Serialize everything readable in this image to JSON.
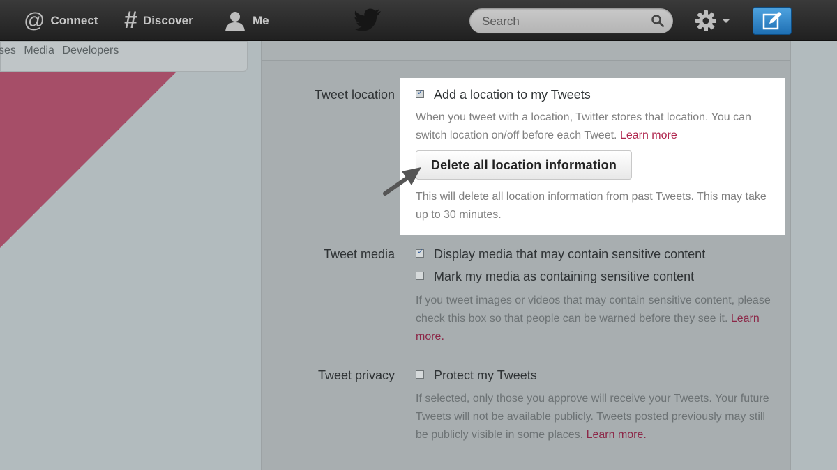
{
  "nav": {
    "connect": "Connect",
    "discover": "Discover",
    "me": "Me",
    "search_placeholder": "Search"
  },
  "icons": {
    "connect": "at-sign-icon",
    "discover": "hashtag-icon",
    "me": "person-icon",
    "logo": "twitter-bird-icon",
    "search": "search-icon",
    "settings": "gear-icon",
    "compose": "compose-icon"
  },
  "left_links": [
    "ses",
    "Media",
    "Developers"
  ],
  "settings": {
    "location": {
      "label": "Tweet location",
      "checkbox_label": "Add a location to my Tweets",
      "checked": true,
      "help": "When you tweet with a location, Twitter stores that location. You can switch location on/off before each Tweet.",
      "help_link": "Learn more",
      "button": "Delete all location information",
      "button_help": "This will delete all location information from past Tweets. This may take up to 30 minutes."
    },
    "media": {
      "label": "Tweet media",
      "option1": "Display media that may contain sensitive content",
      "option1_checked": true,
      "option2": "Mark my media as containing sensitive content",
      "option2_checked": false,
      "help": "If you tweet images or videos that may contain sensitive content, please check this box so that people can be warned before they see it.",
      "help_link": "Learn more."
    },
    "privacy": {
      "label": "Tweet privacy",
      "checkbox_label": "Protect my Tweets",
      "checked": false,
      "help": "If selected, only those you approve will receive your Tweets. Your future Tweets will not be available publicly. Tweets posted previously may still be publicly visible in some places.",
      "help_link": "Learn more."
    }
  },
  "colors": {
    "accent": "#b0264e",
    "topbar": "#2b2b2b",
    "compose": "#2f86cc",
    "pink": "#a64e68"
  }
}
